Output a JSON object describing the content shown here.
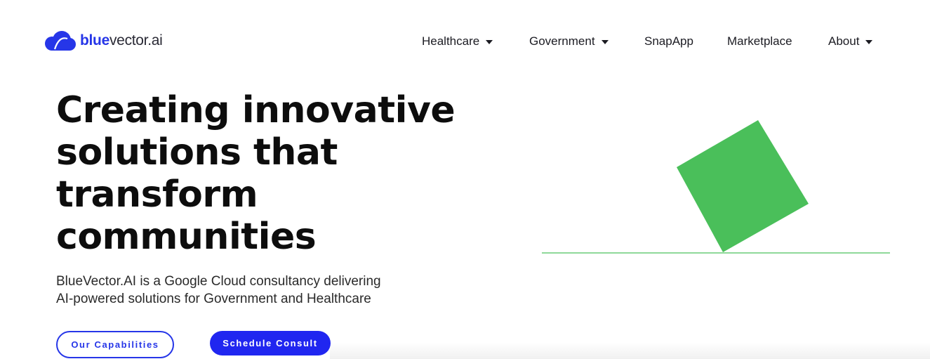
{
  "logo": {
    "brand_strong": "blue",
    "brand_rest": "vector.ai",
    "icon": "cloud-logo-icon",
    "color": "#2636e8"
  },
  "nav": {
    "items": [
      {
        "label": "Healthcare",
        "has_dropdown": true
      },
      {
        "label": "Government",
        "has_dropdown": true
      },
      {
        "label": "SnapApp",
        "has_dropdown": false
      },
      {
        "label": "Marketplace",
        "has_dropdown": false
      },
      {
        "label": "About",
        "has_dropdown": true
      }
    ]
  },
  "hero": {
    "headline_lines": [
      "Creating innovative",
      "solutions that",
      "transform",
      "communities"
    ],
    "subtitle_lines": [
      "BlueVector.AI is a Google Cloud consultancy delivering",
      "AI-powered solutions for Government and Healthcare"
    ],
    "primary_button": "Our Capabilities",
    "secondary_button": "Schedule Consult"
  },
  "illustration": {
    "shape": "tilted-square",
    "fill": "#4abf5a",
    "line_color": "#8fd99a"
  },
  "colors": {
    "accent": "#2636e8",
    "button_fill": "#2026f0",
    "text": "#0d0d0d"
  }
}
